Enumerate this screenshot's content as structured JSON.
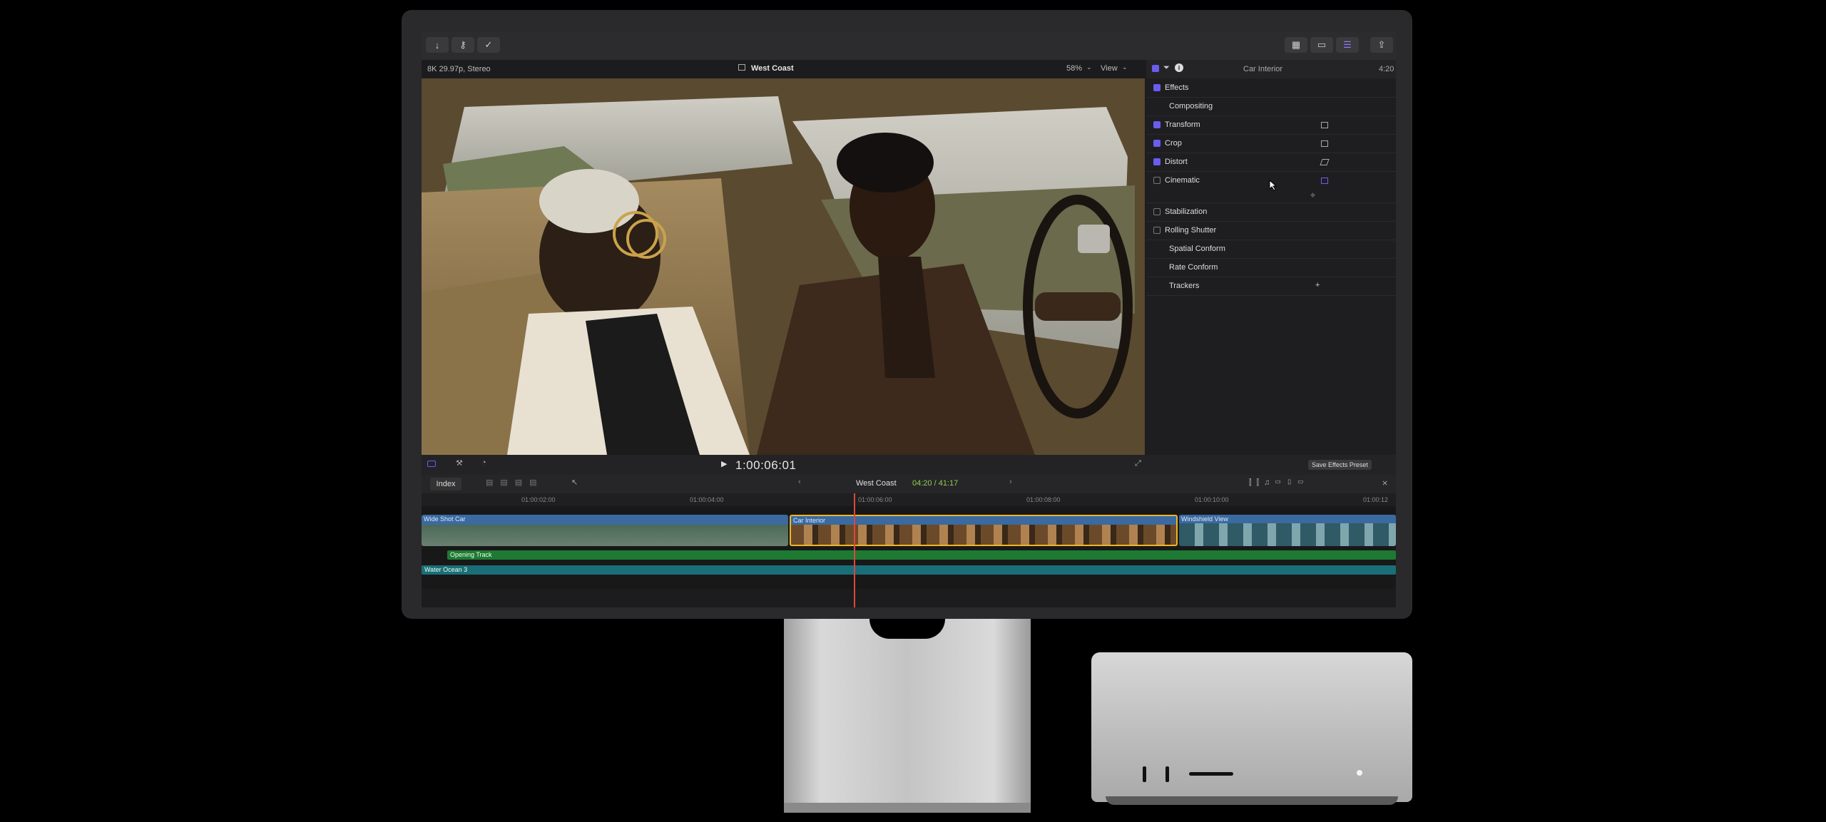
{
  "toolbar": {
    "import_icon": "download-icon",
    "keyword_icon": "key-icon",
    "check_icon": "checkmark-icon",
    "share_icon": "share-icon"
  },
  "viewer": {
    "format": "8K 29.97p, Stereo",
    "project": "West Coast",
    "zoom": "58%",
    "view_menu": "View",
    "timecode": "1:00:06:01"
  },
  "inspector": {
    "clip_name": "Car Interior",
    "duration": "4:20",
    "rows": [
      {
        "label": "Effects",
        "checked": true
      },
      {
        "label": "Compositing",
        "checked": null
      },
      {
        "label": "Transform",
        "checked": true
      },
      {
        "label": "Crop",
        "checked": true
      },
      {
        "label": "Distort",
        "checked": true
      },
      {
        "label": "Cinematic",
        "checked": false
      },
      {
        "label": "Stabilization",
        "checked": false
      },
      {
        "label": "Rolling Shutter",
        "checked": false
      },
      {
        "label": "Spatial Conform",
        "checked": null
      },
      {
        "label": "Rate Conform",
        "checked": null
      },
      {
        "label": "Trackers",
        "checked": null
      }
    ],
    "trackers_add": "+",
    "save_preset": "Save Effects Preset"
  },
  "timeline": {
    "index": "Index",
    "project": "West Coast",
    "position": "04:20 / 41:17",
    "ruler": [
      "01:00:02:00",
      "01:00:04:00",
      "01:00:06:00",
      "01:00:08:00",
      "01:00:10:00",
      "01:00:12"
    ],
    "clips": [
      "Wide Shot Car",
      "Car Interior",
      "Windshield View"
    ],
    "audio": [
      "Opening Track",
      "Water Ocean 3"
    ]
  },
  "colors": {
    "accent": "#6a5cf0",
    "selection": "#f0b429",
    "playhead": "#e0463a",
    "music": "#1e7a33",
    "ambient": "#1a6e78",
    "timecode_green": "#8fd14f"
  }
}
